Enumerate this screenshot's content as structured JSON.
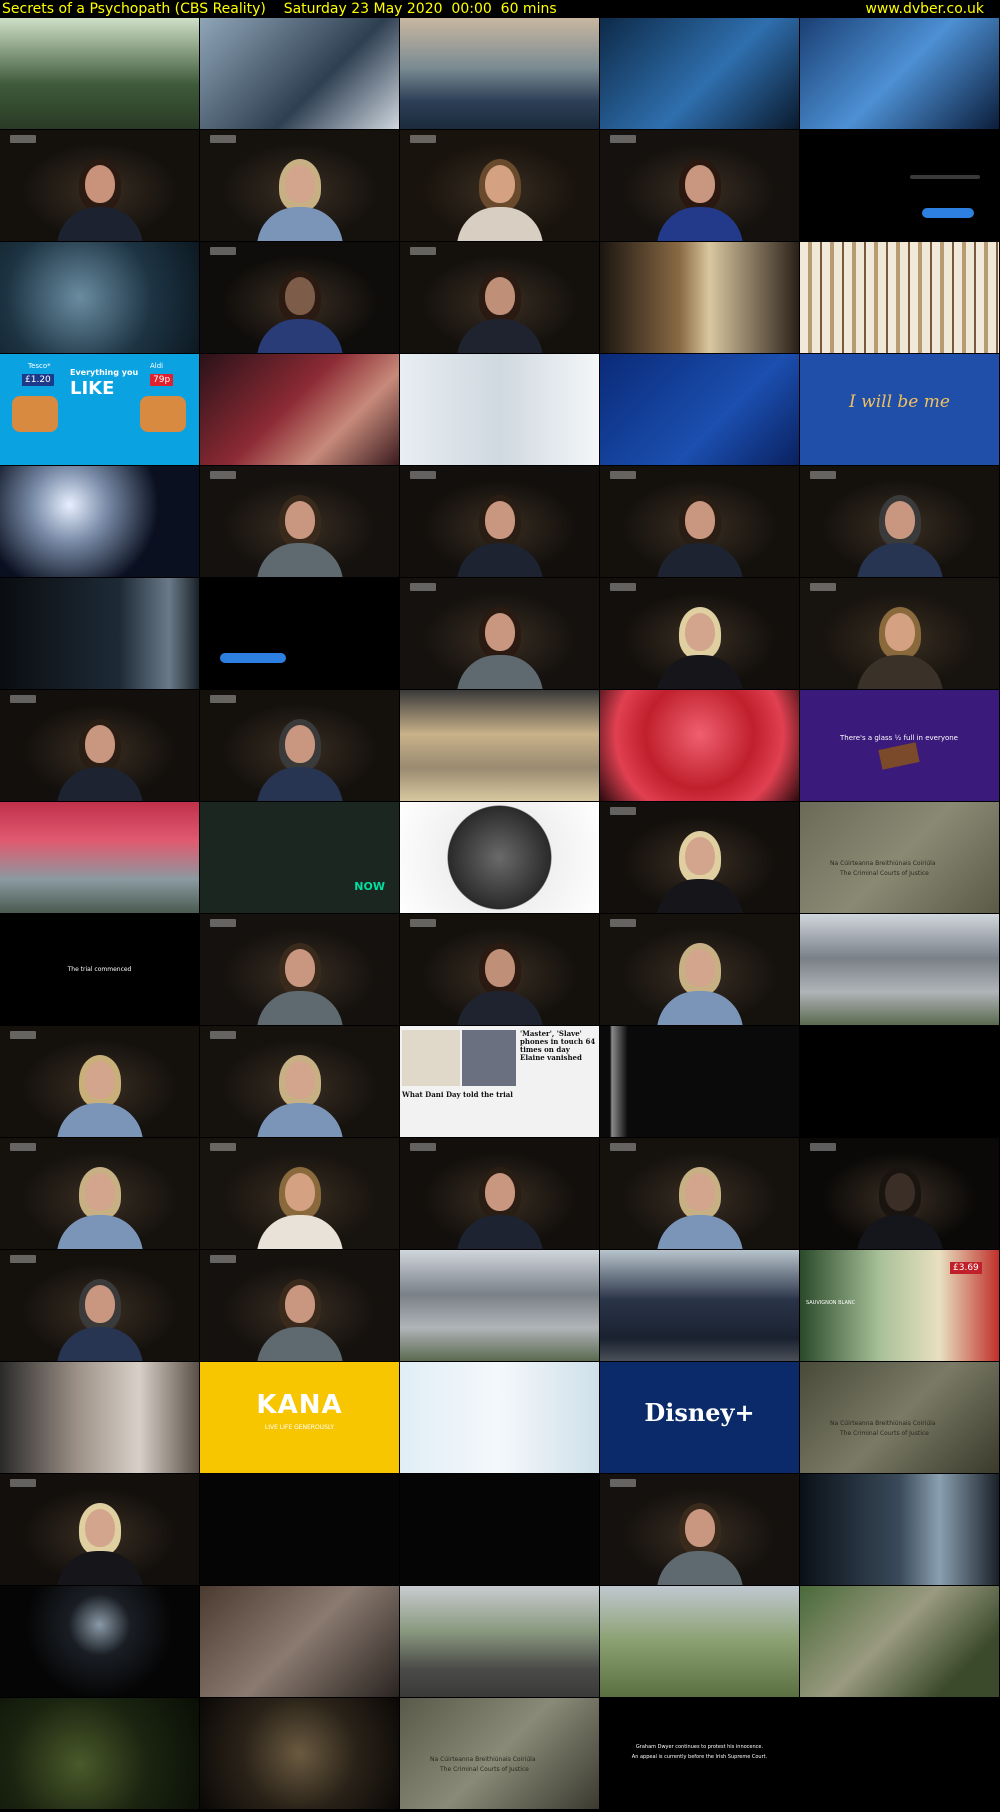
{
  "header": {
    "title": "Secrets of a Psychopath (CBS Reality)    Saturday 23 May 2020  00:00  60 mins",
    "url": "www.dvber.co.uk"
  },
  "colors": {
    "header_text": "#ffff00",
    "background": "#000000"
  },
  "thumbnails": [
    {
      "id": 1,
      "kind": "scene",
      "bg": "linear-gradient(180deg,#cfe0c8,#3e5a3a 60%,#2a3a26)"
    },
    {
      "id": 2,
      "kind": "scene",
      "bg": "linear-gradient(135deg,#8fa6b8,#2f3f52 60%,#cfd7df)"
    },
    {
      "id": 3,
      "kind": "scene",
      "bg": "linear-gradient(180deg,#c9b7a0,#7a8b92 45%,#2d3f57 75%,#1b2a3c)"
    },
    {
      "id": 4,
      "kind": "scene",
      "bg": "linear-gradient(135deg,#0d2a48,#2f6fae 55%,#0a1a2e)"
    },
    {
      "id": 5,
      "kind": "scene",
      "bg": "linear-gradient(135deg,#1a3f73,#4d90d4 50%,#0b1d3a)"
    },
    {
      "id": 6,
      "kind": "interview",
      "bg": "#14110d",
      "hair": "#2a1a12",
      "skin": "#c9927a",
      "clothes": "#1d2230"
    },
    {
      "id": 7,
      "kind": "interview",
      "bg": "#15120e",
      "hair": "#c7b083",
      "skin": "#d3a58c",
      "clothes": "#7b95b8"
    },
    {
      "id": 8,
      "kind": "interview",
      "bg": "#18130d",
      "hair": "#6a4a2c",
      "skin": "#d4a182",
      "clothes": "#d8cfc2"
    },
    {
      "id": 9,
      "kind": "interview",
      "bg": "#14110e",
      "hair": "#2a1810",
      "skin": "#c9977f",
      "clothes": "#233a8a"
    },
    {
      "id": 10,
      "kind": "messages",
      "bg": "#000000"
    },
    {
      "id": 11,
      "kind": "scene",
      "bg": "radial-gradient(circle at 40% 50%,#6a8ca0,#1d3444 55%,#0c1820)"
    },
    {
      "id": 12,
      "kind": "interview",
      "bg": "#0f0d0b",
      "hair": "#2a1a12",
      "skin": "#7e5c4a",
      "clothes": "#2a3c78"
    },
    {
      "id": 13,
      "kind": "interview",
      "bg": "#14110d",
      "hair": "#2a1a12",
      "skin": "#c08f78",
      "clothes": "#1f2330"
    },
    {
      "id": 14,
      "kind": "scene",
      "bg": "linear-gradient(90deg,#1a1510,#8a6a44 40%,#d9c7a0 55%,#2a2018)"
    },
    {
      "id": 15,
      "kind": "scene",
      "bg": "repeating-linear-gradient(90deg,#f1eadb 0 8px,#b89b70 8px 12px,#efe8d6 12px 20px,#7a5a3a 20px 22px)"
    },
    {
      "id": 16,
      "kind": "ad-tesco",
      "bg": "#0aa2e0"
    },
    {
      "id": 17,
      "kind": "scene",
      "bg": "linear-gradient(135deg,#2a1218,#8c2a34 45%,#c78a7a 70%,#3a1a1e)"
    },
    {
      "id": 18,
      "kind": "scene",
      "bg": "linear-gradient(90deg,#e8eef2,#cfd9e0 50%,#f4f6f8)"
    },
    {
      "id": 19,
      "kind": "scene",
      "bg": "linear-gradient(135deg,#0a2a78,#1b4fb0 60%,#0a2160)"
    },
    {
      "id": 20,
      "kind": "ad-ibm",
      "bg": "#1f4fa8"
    },
    {
      "id": 21,
      "kind": "scene",
      "bg": "radial-gradient(circle at 35% 35%,#e8f0ff,#7a8ca8 25%,#0a1020 60%)"
    },
    {
      "id": 22,
      "kind": "interview",
      "bg": "#14110e",
      "hair": "#3a2a1c",
      "skin": "#c9977f",
      "clothes": "#5f6a70"
    },
    {
      "id": 23,
      "kind": "interview",
      "bg": "#120f0c",
      "hair": "#2a1d14",
      "skin": "#c9977f",
      "clothes": "#1d2330"
    },
    {
      "id": 24,
      "kind": "interview",
      "bg": "#14110d",
      "hair": "#2a1d14",
      "skin": "#c9977f",
      "clothes": "#1d2330"
    },
    {
      "id": 25,
      "kind": "interview",
      "bg": "#14110d",
      "hair": "#3a3a3a",
      "skin": "#c9977f",
      "clothes": "#273452"
    },
    {
      "id": 26,
      "kind": "scene",
      "bg": "linear-gradient(90deg,#0a0d10,#1d2a36 60%,#6a7a88 85%,#1a2228)"
    },
    {
      "id": 27,
      "kind": "message-one",
      "bg": "#000000"
    },
    {
      "id": 28,
      "kind": "interview",
      "bg": "#14110e",
      "hair": "#2a1a12",
      "skin": "#c9977f",
      "clothes": "#5f6a70"
    },
    {
      "id": 29,
      "kind": "interview",
      "bg": "#120f0c",
      "hair": "#e0cfa0",
      "skin": "#d3a58c",
      "clothes": "#15151a"
    },
    {
      "id": 30,
      "kind": "interview",
      "bg": "#17130e",
      "hair": "#8a6a3c",
      "skin": "#d4a182",
      "clothes": "#3a3228"
    },
    {
      "id": 31,
      "kind": "interview",
      "bg": "#120f0c",
      "hair": "#2a1d14",
      "skin": "#c9977f",
      "clothes": "#1d2330"
    },
    {
      "id": 32,
      "kind": "interview",
      "bg": "#14110d",
      "hair": "#3a3a3a",
      "skin": "#c9977f",
      "clothes": "#273452"
    },
    {
      "id": 33,
      "kind": "scene",
      "bg": "linear-gradient(180deg,#3a3a3a,#c9b28a 40%,#9a8a70 70%,#d8c8a0)"
    },
    {
      "id": 34,
      "kind": "scene",
      "bg": "radial-gradient(circle at 50% 40%,#f06070,#c0202c 45%,#e04050 70%,#2a0a0e)"
    },
    {
      "id": 35,
      "kind": "ad-glass",
      "bg": "#3a1a7a"
    },
    {
      "id": 36,
      "kind": "scene",
      "bg": "linear-gradient(180deg,#c0304a,#e05a70 35%,#8a9aa0 70%,#4a5a50)"
    },
    {
      "id": 37,
      "kind": "ad-now",
      "bg": "#1c2620"
    },
    {
      "id": 38,
      "kind": "scene",
      "bg": "radial-gradient(circle at 50% 50%,#6a6a6a,#2a2a2a 45%,#f0f0f0 46%,#ffffff)"
    },
    {
      "id": 39,
      "kind": "interview",
      "bg": "#120f0c",
      "hair": "#e0cfa0",
      "skin": "#d3a58c",
      "clothes": "#15151a"
    },
    {
      "id": 40,
      "kind": "courts-wall",
      "bg": "linear-gradient(135deg,#6b6a58,#8a8a74 50%,#5a5a48)"
    },
    {
      "id": 41,
      "kind": "caption",
      "bg": "#000000"
    },
    {
      "id": 42,
      "kind": "interview",
      "bg": "#14110e",
      "hair": "#3a2a1c",
      "skin": "#c9977f",
      "clothes": "#5f6a70"
    },
    {
      "id": 43,
      "kind": "interview",
      "bg": "#14110d",
      "hair": "#2a1a12",
      "skin": "#c08f78",
      "clothes": "#1f2330"
    },
    {
      "id": 44,
      "kind": "interview",
      "bg": "#15120e",
      "hair": "#c7b083",
      "skin": "#d3a58c",
      "clothes": "#7b95b8"
    },
    {
      "id": 45,
      "kind": "scene",
      "bg": "linear-gradient(180deg,#d0d6dc,#7a8088 40%,#b0b4b8 70%,#5a6a50)"
    },
    {
      "id": 46,
      "kind": "interview",
      "bg": "#14110d",
      "hair": "#c9b07a",
      "skin": "#d3a58c",
      "clothes": "#7b95b8"
    },
    {
      "id": 47,
      "kind": "interview",
      "bg": "#15120e",
      "hair": "#c7b083",
      "skin": "#d3a58c",
      "clothes": "#7b95b8"
    },
    {
      "id": 48,
      "kind": "newspaper",
      "bg": "#f2f2f2"
    },
    {
      "id": 49,
      "kind": "scene",
      "bg": "linear-gradient(90deg,#0a0a0a 0 5%,#8a8a8a 6%,#2a2a2a 12%,#0a0a0a 14%)"
    },
    {
      "id": 50,
      "kind": "scene",
      "bg": "#000000"
    },
    {
      "id": 51,
      "kind": "interview",
      "bg": "#15120e",
      "hair": "#c7b083",
      "skin": "#d3a58c",
      "clothes": "#7b95b8"
    },
    {
      "id": 52,
      "kind": "interview",
      "bg": "#17130e",
      "hair": "#8a6a3c",
      "skin": "#d4a182",
      "clothes": "#e8e2d8"
    },
    {
      "id": 53,
      "kind": "interview",
      "bg": "#120f0c",
      "hair": "#2a1d14",
      "skin": "#c9977f",
      "clothes": "#1d2330"
    },
    {
      "id": 54,
      "kind": "interview",
      "bg": "#15120e",
      "hair": "#c7b083",
      "skin": "#d3a58c",
      "clothes": "#7b95b8"
    },
    {
      "id": 55,
      "kind": "interview",
      "bg": "#0a0908",
      "hair": "#1a1410",
      "skin": "#3a2e26",
      "clothes": "#14161c"
    },
    {
      "id": 56,
      "kind": "interview",
      "bg": "#14110d",
      "hair": "#3a3a3a",
      "skin": "#c9977f",
      "clothes": "#273452"
    },
    {
      "id": 57,
      "kind": "interview",
      "bg": "#14110e",
      "hair": "#3a2a1c",
      "skin": "#c9977f",
      "clothes": "#5f6a70"
    },
    {
      "id": 58,
      "kind": "scene",
      "bg": "linear-gradient(180deg,#d0d6dc,#7a8088 40%,#b0b4b8 70%,#5a6a50)"
    },
    {
      "id": 59,
      "kind": "scene",
      "bg": "linear-gradient(180deg,#b8c4cc,#2a3448 45%,#1a2230 80%,#4a5058)"
    },
    {
      "id": 60,
      "kind": "ad-wine",
      "bg": "linear-gradient(90deg,#2a4a2a,#a8c098 40%,#e8e0c0 70%,#c0302a)"
    },
    {
      "id": 61,
      "kind": "scene",
      "bg": "linear-gradient(90deg,#2a2a2a,#a0948a 40%,#d8d0c8 70%,#5a5048)"
    },
    {
      "id": 62,
      "kind": "ad-kana",
      "bg": "#f7c600"
    },
    {
      "id": 63,
      "kind": "scene",
      "bg": "linear-gradient(90deg,#e0eef6,#f4f8fb 50%,#cfe0ea)"
    },
    {
      "id": 64,
      "kind": "ad-disney",
      "bg": "#0a2a6a"
    },
    {
      "id": 65,
      "kind": "courts-wall",
      "bg": "linear-gradient(135deg,#4a4a3a,#7a7a66 50%,#3a3a2c)"
    },
    {
      "id": 66,
      "kind": "interview",
      "bg": "#120f0c",
      "hair": "#e0cfa0",
      "skin": "#d3a58c",
      "clothes": "#15151a"
    },
    {
      "id": 67,
      "kind": "scene",
      "bg": "#050505"
    },
    {
      "id": 68,
      "kind": "scene",
      "bg": "#050505"
    },
    {
      "id": 69,
      "kind": "interview",
      "bg": "#14110e",
      "hair": "#3a2a1c",
      "skin": "#c9977f",
      "clothes": "#5f6a70"
    },
    {
      "id": 70,
      "kind": "scene",
      "bg": "linear-gradient(90deg,#0a1018,#3a4a5a 50%,#8aa0b0 70%,#1a2028)"
    },
    {
      "id": 71,
      "kind": "scene",
      "bg": "radial-gradient(circle at 50% 35%,#8a9aa8,#1a1e24 25%,#050505 60%)"
    },
    {
      "id": 72,
      "kind": "scene",
      "bg": "linear-gradient(135deg,#4a3a30,#8a7a70 50%,#2a2420)"
    },
    {
      "id": 73,
      "kind": "scene",
      "bg": "linear-gradient(180deg,#c8ccd0,#8a9a80 40%,#4a4a48 75%,#3a3a38)"
    },
    {
      "id": 74,
      "kind": "scene",
      "bg": "linear-gradient(180deg,#c0c8d0,#8aa070 50%,#5a7040)"
    },
    {
      "id": 75,
      "kind": "scene",
      "bg": "linear-gradient(135deg,#4a6a3a,#9a9a80 45%,#3a4a2a 80%)"
    },
    {
      "id": 76,
      "kind": "scene",
      "bg": "radial-gradient(circle at 40% 60%,#4a5a2a,#1a2410 50%,#0a0e06)"
    },
    {
      "id": 77,
      "kind": "scene",
      "bg": "radial-gradient(circle at 50% 50%,#6a5a40,#2a2218 50%,#0a0806)"
    },
    {
      "id": 78,
      "kind": "courts-wall",
      "bg": "linear-gradient(135deg,#5a5a4a,#8a8a78 50%,#3a3a30)"
    },
    {
      "id": 79,
      "kind": "caption2",
      "bg": "#000000"
    }
  ],
  "texts": {
    "ad_tesco": {
      "tesco": "Tesco*",
      "aldi": "Aldi",
      "headline": "Everything you",
      "like": "LIKE",
      "price1": "£1.20",
      "price2": "79p"
    },
    "ad_ibm": {
      "line": "I will be me"
    },
    "ad_glass": {
      "line": "There's a glass ½ full in everyone"
    },
    "ad_now": {
      "brand": "NOW"
    },
    "ad_kana": {
      "brand": "KANA",
      "tagline": "LIVE LIFE GENEROUSLY"
    },
    "ad_disney": {
      "brand": "Disney+"
    },
    "ad_wine": {
      "price": "£3.69",
      "label": "SAUVIGNON BLANC"
    },
    "courts": {
      "irish": "Na Cúirteanna Breithiúnais Coiriúla",
      "english": "The Criminal Courts of Justice"
    },
    "caption": "The trial commenced",
    "caption2": {
      "line1": "Graham Dwyer continues to protest his innocence.",
      "line2": "An appeal is currently before the Irish Supreme Court."
    },
    "newspaper": {
      "headline": "'Master', 'Slave' phones in touch 64 times on day Elaine vanished",
      "sub": "What Dani Day told the trial"
    }
  }
}
